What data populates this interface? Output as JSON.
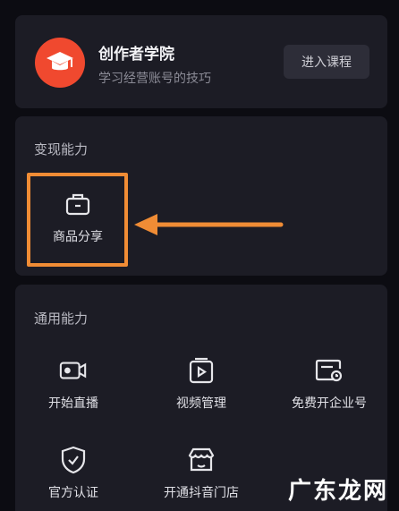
{
  "academy": {
    "title": "创作者学院",
    "subtitle": "学习经营账号的技巧",
    "enter_button": "进入课程"
  },
  "monetize": {
    "title": "变现能力",
    "items": [
      {
        "label": "商品分享",
        "icon": "briefcase-icon"
      }
    ]
  },
  "common": {
    "title": "通用能力",
    "items": [
      {
        "label": "开始直播",
        "icon": "camera-icon"
      },
      {
        "label": "视频管理",
        "icon": "video-folder-icon"
      },
      {
        "label": "免费开企业号",
        "icon": "enterprise-card-icon"
      },
      {
        "label": "官方认证",
        "icon": "shield-check-icon"
      },
      {
        "label": "开通抖音门店",
        "icon": "store-icon"
      }
    ]
  },
  "annotation": {
    "highlight_color": "#f08c35"
  },
  "watermark": "广东龙网",
  "colors": {
    "background": "#0c0c12",
    "card": "#1c1c25",
    "logo": "#f0492f",
    "accent": "#f08c35"
  }
}
